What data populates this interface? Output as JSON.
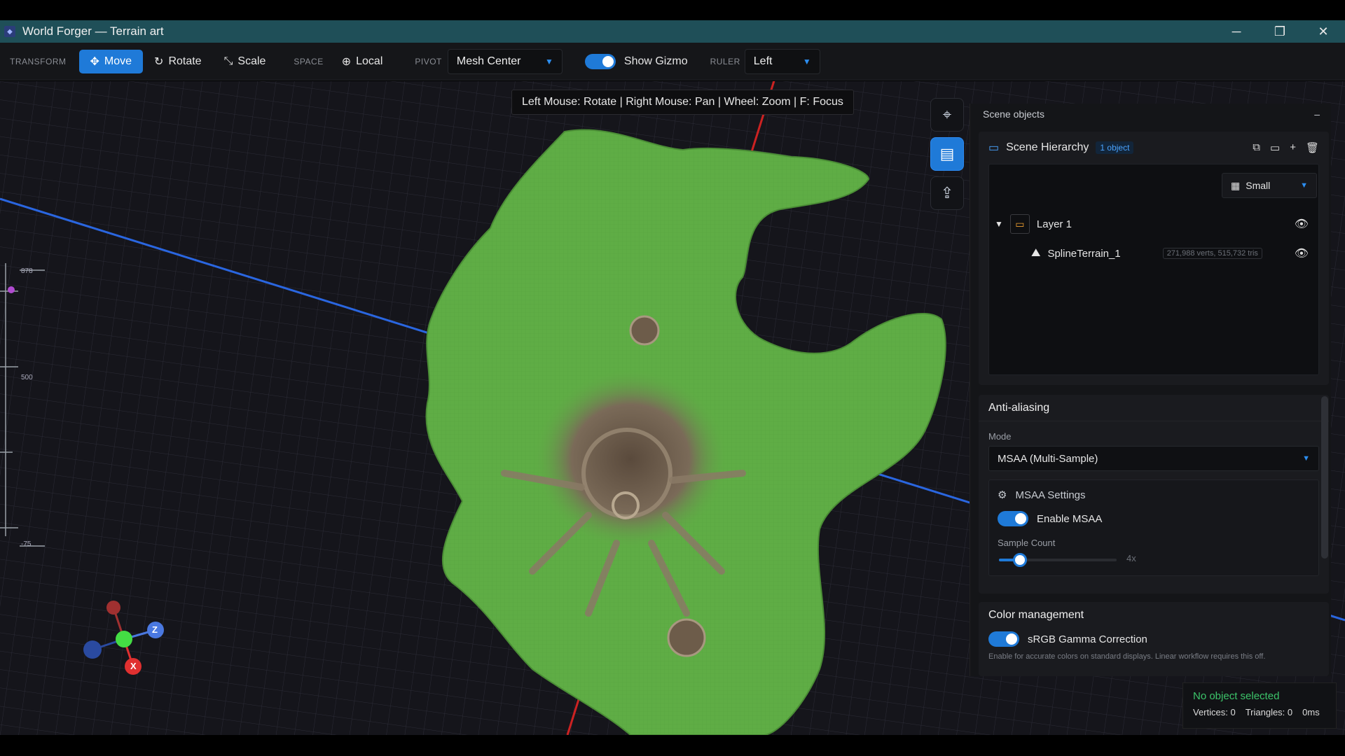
{
  "window": {
    "title": "World Forger — Terrain art",
    "minimize": "─",
    "restore": "❐",
    "close": "✕"
  },
  "toolbar": {
    "transform_label": "TRANSFORM",
    "move": "Move",
    "rotate": "Rotate",
    "scale": "Scale",
    "space_label": "SPACE",
    "space_value": "Local",
    "pivot_label": "PIVOT",
    "pivot_value": "Mesh Center",
    "gizmo_label": "Show Gizmo",
    "gizmo_on": true,
    "ruler_label": "RULER",
    "ruler_value": "Left"
  },
  "viewport": {
    "hint": "Left Mouse: Rotate | Right Mouse: Pan | Wheel: Zoom | F: Focus",
    "ruler_ticks": [
      "878",
      "500",
      "-75"
    ],
    "gizmo_axes": {
      "z": "Z",
      "x": "X"
    }
  },
  "scene_panel": {
    "title": "Scene objects",
    "collapse": "–",
    "hierarchy": {
      "title": "Scene Hierarchy",
      "count_badge": "1 object",
      "size_value": "Small",
      "items": [
        {
          "name": "Layer 1"
        },
        {
          "name": "SplineTerrain_1",
          "stats": "271,988 verts, 515,732 tris"
        }
      ]
    },
    "anti_aliasing": {
      "title": "Anti-aliasing",
      "mode_label": "Mode",
      "mode_value": "MSAA (Multi-Sample)",
      "msaa_settings_title": "MSAA Settings",
      "enable_label": "Enable MSAA",
      "enable_on": true,
      "sample_label": "Sample Count",
      "sample_value": "4x",
      "sample_fraction": 0.18
    },
    "color_management": {
      "title": "Color management",
      "srgb_label": "sRGB Gamma Correction",
      "srgb_on": true,
      "srgb_help": "Enable for accurate colors on standard displays. Linear workflow requires this off."
    }
  },
  "status": {
    "selection": "No object selected",
    "vertices": "Vertices: 0",
    "triangles": "Triangles: 0",
    "time": "0ms"
  },
  "colors": {
    "accent": "#1f7ad8",
    "terrain": "#5fad45",
    "selection_ok": "#3cc46a"
  }
}
